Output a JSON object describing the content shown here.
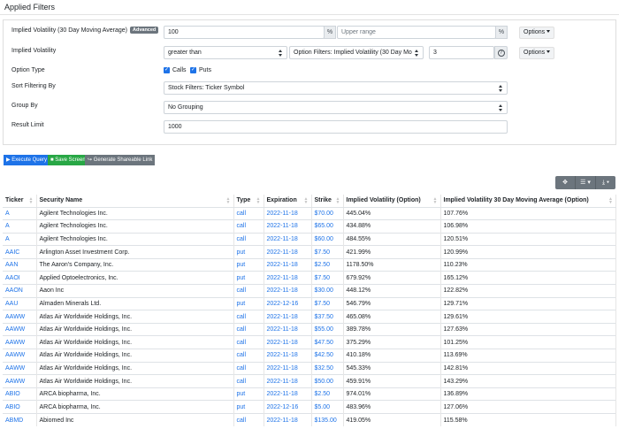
{
  "page_title": "Applied Filters",
  "filters": {
    "iv_ma_label": "Implied Volatility (30 Day Moving Average)",
    "iv_ma_badge": "Advanced",
    "iv_ma_lower": "100",
    "iv_ma_unit": "%",
    "iv_ma_upper_placeholder": "Upper range",
    "iv_ma_upper_unit": "%",
    "options_label": "Options",
    "iv_label": "Implied Volatility",
    "iv_operator": "greater than",
    "iv_compare_field": "Option Filters: Implied Volatility (30 Day Mo",
    "iv_value": "3",
    "iv_help": "?",
    "option_type_label": "Option Type",
    "calls_label": "Calls",
    "puts_label": "Puts",
    "sort_label": "Sort Filtering By",
    "sort_value": "Stock Filters: Ticker Symbol",
    "group_label": "Group By",
    "group_value": "No Grouping",
    "limit_label": "Result Limit",
    "limit_value": "1000"
  },
  "actions": {
    "execute": "Execute Query",
    "save": "Save Screen",
    "share": "Generate Shareable Link"
  },
  "colors": {
    "execute": "#1e73e8",
    "save": "#28a745",
    "share": "#6c757d"
  },
  "table": {
    "headers": [
      "Ticker",
      "Security Name",
      "Type",
      "Expiration",
      "Strike",
      "Implied Volatility (Option)",
      "Implied Volatility 30 Day Moving Average (Option)"
    ],
    "rows": [
      [
        "A",
        "Agilent Technologies Inc.",
        "call",
        "2022-11-18",
        "$70.00",
        "445.04%",
        "107.76%"
      ],
      [
        "A",
        "Agilent Technologies Inc.",
        "call",
        "2022-11-18",
        "$65.00",
        "434.88%",
        "106.98%"
      ],
      [
        "A",
        "Agilent Technologies Inc.",
        "call",
        "2022-11-18",
        "$60.00",
        "484.55%",
        "120.51%"
      ],
      [
        "AAIC",
        "Arlington Asset Investment Corp.",
        "put",
        "2022-11-18",
        "$7.50",
        "421.99%",
        "120.99%"
      ],
      [
        "AAN",
        "The Aaron's Company, Inc.",
        "put",
        "2022-11-18",
        "$2.50",
        "1178.50%",
        "110.23%"
      ],
      [
        "AAOI",
        "Applied Optoelectronics, Inc.",
        "put",
        "2022-11-18",
        "$7.50",
        "679.92%",
        "165.12%"
      ],
      [
        "AAON",
        "Aaon Inc",
        "call",
        "2022-11-18",
        "$30.00",
        "448.12%",
        "122.82%"
      ],
      [
        "AAU",
        "Almaden Minerals Ltd.",
        "put",
        "2022-12-16",
        "$7.50",
        "546.79%",
        "129.71%"
      ],
      [
        "AAWW",
        "Atlas Air Worldwide Holdings, Inc.",
        "call",
        "2022-11-18",
        "$37.50",
        "465.08%",
        "129.61%"
      ],
      [
        "AAWW",
        "Atlas Air Worldwide Holdings, Inc.",
        "call",
        "2022-11-18",
        "$55.00",
        "389.78%",
        "127.63%"
      ],
      [
        "AAWW",
        "Atlas Air Worldwide Holdings, Inc.",
        "call",
        "2022-11-18",
        "$47.50",
        "375.29%",
        "101.25%"
      ],
      [
        "AAWW",
        "Atlas Air Worldwide Holdings, Inc.",
        "call",
        "2022-11-18",
        "$42.50",
        "410.18%",
        "113.69%"
      ],
      [
        "AAWW",
        "Atlas Air Worldwide Holdings, Inc.",
        "call",
        "2022-11-18",
        "$32.50",
        "545.33%",
        "142.81%"
      ],
      [
        "AAWW",
        "Atlas Air Worldwide Holdings, Inc.",
        "call",
        "2022-11-18",
        "$50.00",
        "459.91%",
        "143.29%"
      ],
      [
        "ABIO",
        "ARCA biopharma, Inc.",
        "put",
        "2022-11-18",
        "$2.50",
        "974.01%",
        "136.89%"
      ],
      [
        "ABIO",
        "ARCA biopharma, Inc.",
        "put",
        "2022-12-16",
        "$5.00",
        "483.96%",
        "127.06%"
      ],
      [
        "ABMD",
        "Abiomed Inc",
        "call",
        "2022-11-18",
        "$135.00",
        "419.05%",
        "115.58%"
      ]
    ]
  }
}
